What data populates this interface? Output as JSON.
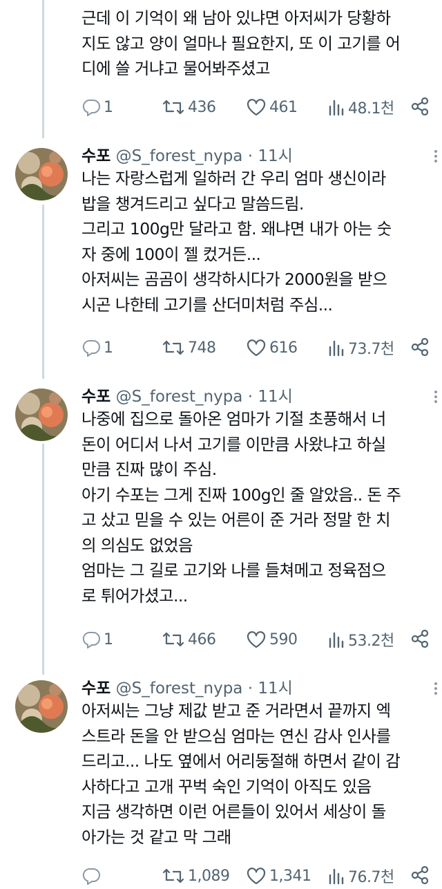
{
  "tweets": [
    {
      "lines": [
        "근데 이 기억이 왜 남아 있냐면 아저씨가 당황하",
        "지도 않고 양이 얼마나 필요한지, 또 이 고기를 어",
        "디에 쓸 거냐고 물어봐주셨고"
      ],
      "replies": "1",
      "retweets": "436",
      "likes": "461",
      "views": "48.1천"
    },
    {
      "name": "수포",
      "handle": "@S_forest_nypa",
      "time": "· 11시",
      "lines": [
        "나는 자랑스럽게 일하러 간 우리 엄마 생신이라",
        "밥을 챙겨드리고 싶다고 말씀드림.",
        "그리고 100g만 달라고 함. 왜냐면 내가 아는 숫",
        "자 중에 100이 젤 컸거든...",
        "아저씨는 곰곰이 생각하시다가 2000원을 받으",
        "시곤 나한테 고기를 산더미처럼 주심..."
      ],
      "replies": "1",
      "retweets": "748",
      "likes": "616",
      "views": "73.7천"
    },
    {
      "name": "수포",
      "handle": "@S_forest_nypa",
      "time": "· 11시",
      "lines": [
        "나중에 집으로 돌아온 엄마가 기절 초풍해서 너",
        "돈이 어디서 나서 고기를 이만큼 사왔냐고 하실",
        "만큼 진짜 많이 주심.",
        "아기 수포는 그게 진짜 100g인 줄 알았음.. 돈 주",
        "고 샀고 믿을 수 있는 어른이 준 거라 정말 한 치",
        "의 의심도 없었음",
        "엄마는 그 길로 고기와 나를 들쳐메고 정육점으",
        "로 튀어가셨고..."
      ],
      "replies": "1",
      "retweets": "466",
      "likes": "590",
      "views": "53.2천"
    },
    {
      "name": "수포",
      "handle": "@S_forest_nypa",
      "time": "· 11시",
      "lines": [
        "아저씨는 그냥 제값 받고 준 거라면서 끝까지 엑",
        "스트라 돈을 안 받으심 엄마는 연신 감사 인사를",
        "드리고... 나도 옆에서 어리둥절해 하면서 같이 감",
        "사하다고 고개 꾸벅 숙인 기억이 아직도 있음",
        "지금 생각하면 이런 어른들이 있어서 세상이 돌",
        "아가는 것 같고 막 그래"
      ],
      "replies": "",
      "retweets": "1,089",
      "likes": "1,341",
      "views": "76.7천"
    }
  ],
  "icons": {
    "reply": "reply-icon",
    "retweet": "retweet-icon",
    "like": "heart-icon",
    "views": "views-chart-icon",
    "share": "share-icon",
    "more": "more-dots-icon"
  },
  "colors": {
    "text": "#0f1419",
    "muted": "#536471",
    "thread": "#cfd9de"
  }
}
